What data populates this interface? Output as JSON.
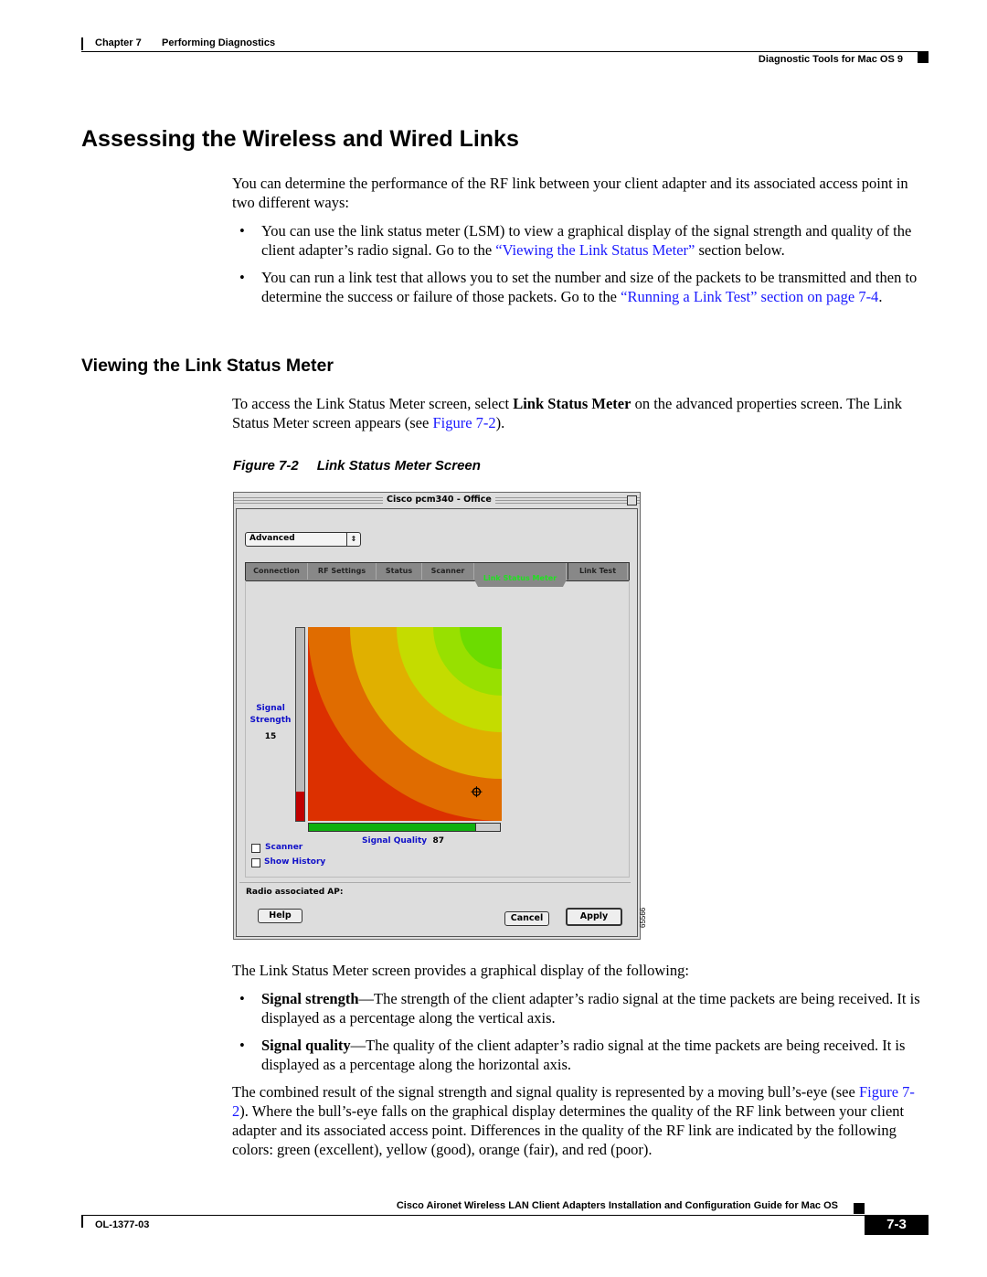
{
  "header": {
    "chapter": "Chapter 7",
    "chapter_title": "Performing Diagnostics",
    "section": "Diagnostic Tools for Mac OS 9"
  },
  "h1": "Assessing the Wireless and Wired Links",
  "intro": "You can determine the performance of the RF link between your client adapter and its associated access point in two different ways:",
  "bullets1": [
    {
      "pre": "You can use the link status meter (LSM) to view a graphical display of the signal strength and quality of the client adapter’s radio signal. Go to the ",
      "link": "“Viewing the Link Status Meter”",
      "post": " section below."
    },
    {
      "pre": "You can run a link test that allows you to set the number and size of the packets to be transmitted and then to determine the success or failure of those packets. Go to the ",
      "link": "“Running a Link Test” section on page 7-4",
      "post": "."
    }
  ],
  "h2": "Viewing the Link Status Meter",
  "access": {
    "pre": "To access the Link Status Meter screen, select ",
    "bold": "Link Status Meter",
    "mid": " on the advanced properties screen. The Link Status Meter screen appears (see ",
    "link": "Figure 7-2",
    "post": ")."
  },
  "figure": {
    "number": "Figure 7-2",
    "caption": "Link Status Meter Screen",
    "art_id": "65566"
  },
  "window": {
    "title": "Cisco pcm340 - Office",
    "dropdown": "Advanced",
    "tabs": [
      "Connection",
      "RF Settings",
      "Status",
      "Scanner",
      "Link Status Meter",
      "Link Test"
    ],
    "active_tab": "Link Status Meter",
    "strength_label1": "Signal",
    "strength_label2": "Strength",
    "strength_value": "15",
    "signal_strength_percent": 15,
    "quality_label": "Signal Quality",
    "quality_value": "87",
    "signal_quality_percent": 87,
    "checkboxes": [
      {
        "label": "Scanner",
        "checked": false
      },
      {
        "label": "Show History",
        "checked": false
      }
    ],
    "radio_ap_label": "Radio associated AP:",
    "help": "Help",
    "cancel": "Cancel",
    "apply": "Apply",
    "colors": {
      "green": "#6cdc00",
      "yellow_green": "#98e000",
      "lime": "#c4dc00",
      "yellow": "#e0b000",
      "orange": "#e06c00",
      "red": "#dc3000"
    }
  },
  "after": "The Link Status Meter screen provides a graphical display of the following:",
  "bullets2": [
    {
      "bold": "Signal strength",
      "text": "—The strength of the client adapter’s radio signal at the time packets are being received. It is displayed as a percentage along the vertical axis."
    },
    {
      "bold": "Signal quality",
      "text": "—The quality of the client adapter’s radio signal at the time packets are being received. It is displayed as a percentage along the horizontal axis."
    }
  ],
  "final": {
    "pre": "The combined result of the signal strength and signal quality is represented by a moving bull’s-eye (see ",
    "link": "Figure 7-2",
    "post": "). Where the bull’s-eye falls on the graphical display determines the quality of the RF link between your client adapter and its associated access point. Differences in the quality of the RF link are indicated by the following colors: green (excellent), yellow (good), orange (fair), and red (poor)."
  },
  "footer": {
    "title": "Cisco Aironet Wireless LAN Client Adapters Installation and Configuration Guide for Mac OS",
    "doc": "OL-1377-03",
    "page": "7-3"
  }
}
